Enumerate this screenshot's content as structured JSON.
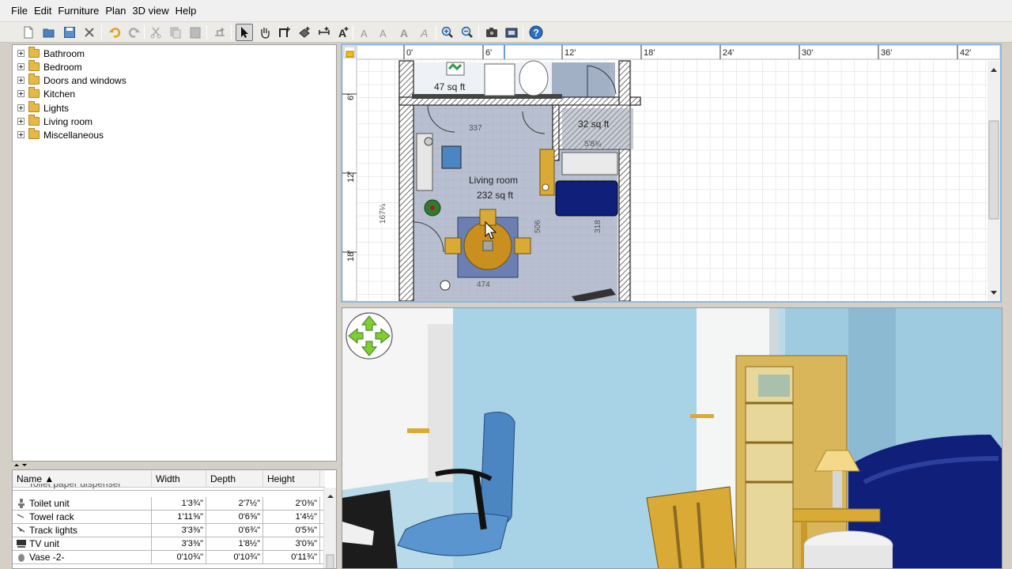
{
  "menu": [
    "File",
    "Edit",
    "Furniture",
    "Plan",
    "3D view",
    "Help"
  ],
  "toolbar": {
    "buttons": [
      "new-icon",
      "open-icon",
      "save-icon",
      "cut-tool-icon",
      "undo-icon",
      "redo-icon",
      "cut-icon",
      "copy-icon",
      "paste-icon",
      "add-furniture-icon",
      "select-icon",
      "pan-icon",
      "create-walls-icon",
      "create-rooms-icon",
      "create-dimensions-icon",
      "add-text-icon",
      "text-style-icon",
      "increase-text-icon",
      "bold-icon",
      "italic-icon",
      "zoom-in-icon",
      "zoom-out-icon",
      "create-photo-icon",
      "create-video-icon",
      "help-icon"
    ]
  },
  "catalog": {
    "categories": [
      "Bathroom",
      "Bedroom",
      "Doors and windows",
      "Kitchen",
      "Lights",
      "Living room",
      "Miscellaneous"
    ]
  },
  "furniture_table": {
    "columns": [
      "Name ▲",
      "Width",
      "Depth",
      "Height"
    ],
    "partial_top_row": "Toilet paper dispenser",
    "rows": [
      {
        "name": "Toilet unit",
        "width": "1'3¾\"",
        "depth": "2'7½\"",
        "height": "2'0⅜\""
      },
      {
        "name": "Towel rack",
        "width": "1'11⅝\"",
        "depth": "0'6⅝\"",
        "height": "1'4½\""
      },
      {
        "name": "Track lights",
        "width": "3'3⅜\"",
        "depth": "0'6¾\"",
        "height": "0'5⅜\""
      },
      {
        "name": "TV unit",
        "width": "3'3⅜\"",
        "depth": "1'8½\"",
        "height": "3'0⅝\""
      },
      {
        "name": "Vase -2-",
        "width": "0'10¾\"",
        "depth": "0'10¾\"",
        "height": "0'11¾\""
      }
    ]
  },
  "plan": {
    "ruler_top": [
      "0'",
      "6'",
      "12'",
      "18'",
      "24'",
      "30'",
      "36'",
      "42'"
    ],
    "ruler_left": [
      "6'",
      "12'",
      "18'"
    ],
    "rooms": [
      {
        "label": "47 sq ft"
      },
      {
        "label": "32 sq ft"
      },
      {
        "label": "Living room",
        "area": "232 sq ft"
      }
    ],
    "dimensions": [
      "167¼",
      "337",
      "474",
      "506",
      "318",
      "5'8¾"
    ]
  },
  "colors": {
    "accent": "#8fb8e0",
    "wall": "#3c3c3c",
    "sky": "#b9dbe9",
    "wood": "#d9aa35",
    "sofa": "#0f1f7a"
  }
}
